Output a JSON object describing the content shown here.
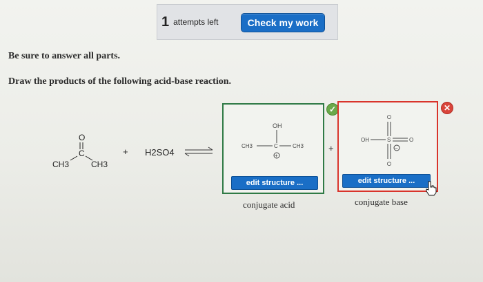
{
  "header": {
    "attempts_count": "1",
    "attempts_label": "attempts left",
    "check_button": "Check my work"
  },
  "instructions": {
    "line1": "Be sure to answer all parts.",
    "line2": "Draw the products of the following acid-base reaction."
  },
  "reaction": {
    "reactant_carbonyl_o": "O",
    "reactant_c": "C",
    "reactant_ch3_left": "CH3",
    "reactant_ch3_right": "CH3",
    "plus": "+",
    "acid": "H2SO4"
  },
  "acid_product": {
    "oh": "OH",
    "ch3_left": "CH3",
    "c": "C",
    "ch3_right": "CH3",
    "charge": "+",
    "edit_label": "edit structure ...",
    "caption": "conjugate acid",
    "status": "correct"
  },
  "base_product": {
    "oh": "OH",
    "s": "S",
    "o_top": "O",
    "o_right": "O",
    "o_bottom": "O",
    "charge": "−",
    "edit_label": "edit structure ...",
    "caption": "conjugate base",
    "status": "incorrect"
  },
  "products_plus": "+",
  "colors": {
    "button_blue": "#1a6ec6",
    "correct_green": "#2f7a45",
    "incorrect_red": "#d9342b"
  }
}
